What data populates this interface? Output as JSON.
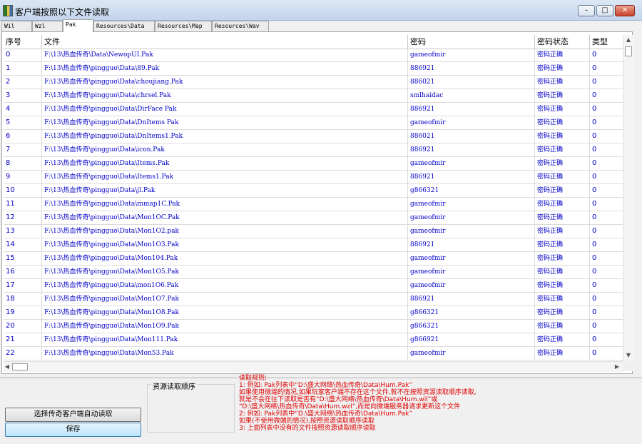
{
  "window": {
    "title": "客户端按照以下文件读取",
    "controls": {
      "minimize": "–",
      "maximize": "□",
      "close": "✕"
    }
  },
  "tabs": [
    {
      "label": "Wil"
    },
    {
      "label": "Wzl"
    },
    {
      "label": "Pak",
      "active": true
    },
    {
      "label": "Resources\\Data"
    },
    {
      "label": "Resources\\Map"
    },
    {
      "label": "Resources\\Wav"
    }
  ],
  "table": {
    "columns": [
      "序号",
      "文件",
      "密码",
      "密码状态",
      "类型"
    ],
    "rows": [
      {
        "idx": "0",
        "file": "F:\\13\\热血传奇\\Data\\NewopUI.Pak",
        "pwd": "gameofmir",
        "status": "密码正确",
        "type": "0"
      },
      {
        "idx": "1",
        "file": "F:\\13\\热血传奇\\pingguo\\Data\\89.Pak",
        "pwd": "886921",
        "status": "密码正确",
        "type": "0"
      },
      {
        "idx": "2",
        "file": "F:\\13\\热血传奇\\pingguo\\Data\\choujiang.Pak",
        "pwd": "886021",
        "status": "密码正确",
        "type": "0"
      },
      {
        "idx": "3",
        "file": "F:\\13\\热血传奇\\pingguo\\Data\\chrsel.Pak",
        "pwd": "smlhaidac",
        "status": "密码正确",
        "type": "0"
      },
      {
        "idx": "4",
        "file": "F:\\13\\热血传奇\\pingguo\\Data\\DirFace Pak",
        "pwd": "886921",
        "status": "密码正确",
        "type": "0"
      },
      {
        "idx": "5",
        "file": "F:\\13\\热血传奇\\pingguo\\Data\\DnItems Pak",
        "pwd": "gameofmir",
        "status": "密码正确",
        "type": "0"
      },
      {
        "idx": "6",
        "file": "F:\\13\\热血传奇\\pingguo\\Data\\DnItems1.Pak",
        "pwd": "886021",
        "status": "密码正确",
        "type": "0"
      },
      {
        "idx": "7",
        "file": "F:\\13\\热血传奇\\pingguo\\Data\\icon.Pak",
        "pwd": "886921",
        "status": "密码正确",
        "type": "0"
      },
      {
        "idx": "8",
        "file": "F:\\13\\热血传奇\\pingguo\\Data\\Items.Pak",
        "pwd": "gameofmir",
        "status": "密码正确",
        "type": "0"
      },
      {
        "idx": "9",
        "file": "F:\\13\\热血传奇\\pingguo\\Data\\Items1.Pak",
        "pwd": "886921",
        "status": "密码正确",
        "type": "0"
      },
      {
        "idx": "10",
        "file": "F:\\13\\热血传奇\\pingguo\\Data\\jl.Pak",
        "pwd": "g866321",
        "status": "密码正确",
        "type": "0"
      },
      {
        "idx": "11",
        "file": "F:\\13\\热血传奇\\pingguo\\Data\\mmap1C.Pak",
        "pwd": "gameofmir",
        "status": "密码正确",
        "type": "0"
      },
      {
        "idx": "12",
        "file": "F:\\13\\热血传奇\\pingguo\\Data\\Mon1OC.Pak",
        "pwd": "gameofmir",
        "status": "密码正确",
        "type": "0"
      },
      {
        "idx": "13",
        "file": "F:\\13\\热血传奇\\pingguo\\Data\\Mon1O2.pak",
        "pwd": "gameofmir",
        "status": "密码正确",
        "type": "0"
      },
      {
        "idx": "14",
        "file": "F:\\13\\热血传奇\\pingguo\\Data\\Mon1O3.Pak",
        "pwd": "886921",
        "status": "密码正确",
        "type": "0"
      },
      {
        "idx": "15",
        "file": "F:\\13\\热血传奇\\pingguo\\Data\\Mon104.Pak",
        "pwd": "gameofmir",
        "status": "密码正确",
        "type": "0"
      },
      {
        "idx": "16",
        "file": "F:\\13\\热血传奇\\pingguo\\Data\\Mon1O5.Pak",
        "pwd": "gameofmir",
        "status": "密码正确",
        "type": "0"
      },
      {
        "idx": "17",
        "file": "F:\\13\\热血传奇\\pingguo\\Data\\mon1O6.Pak",
        "pwd": "gameofmir",
        "status": "密码正确",
        "type": "0"
      },
      {
        "idx": "18",
        "file": "F:\\13\\热血传奇\\pingguo\\Data\\Mon1O7.Pak",
        "pwd": "886921",
        "status": "密码正确",
        "type": "0"
      },
      {
        "idx": "19",
        "file": "F:\\13\\热血传奇\\pingguo\\Data\\Mon1O8.Pak",
        "pwd": "g866321",
        "status": "密码正确",
        "type": "0"
      },
      {
        "idx": "20",
        "file": "F:\\13\\热血传奇\\pingguo\\Data\\Mon1O9.Pak",
        "pwd": "g866321",
        "status": "密码正确",
        "type": "0"
      },
      {
        "idx": "21",
        "file": "F:\\13\\热血传奇\\pingguo\\Data\\Mon111.Pak",
        "pwd": "g866921",
        "status": "密码正确",
        "type": "0"
      },
      {
        "idx": "22",
        "file": "F:\\13\\热血传奇\\pingguo\\Data\\Mon53.Pak",
        "pwd": "gameofmir",
        "status": "密码正确",
        "type": "0"
      }
    ]
  },
  "bottom": {
    "order_label": "资源读取顺序",
    "auto_read_button": "选择传奇客户端自动读取",
    "save_button": "保存",
    "rules": [
      "读取规则:",
      "1: 例如: Pak列表中“D:\\盛大网络\\热血传奇\\Data\\Hum.Pak”",
      "   如果使用微端的情况,如果玩家客户端不存在这个文件,就不在按照资源读取顺序读取,",
      "   就是不会在往下读取是否有“D:\\盛大网络\\热血传奇\\Data\\Hum.wil”或",
      "   “D:\\盛大网络\\热血传奇\\Data\\Hum.wzl”,而是向微端服务器请求更新这个文件",
      "2: 例如: Pak列表中“D:\\盛大网络\\热血传奇\\Data\\Hum.Pak”",
      "   如果(不使用微端的情况),按照资源读取顺序读取",
      "3: 上面列表中没有的文件按照资源读取顺序读取"
    ]
  }
}
